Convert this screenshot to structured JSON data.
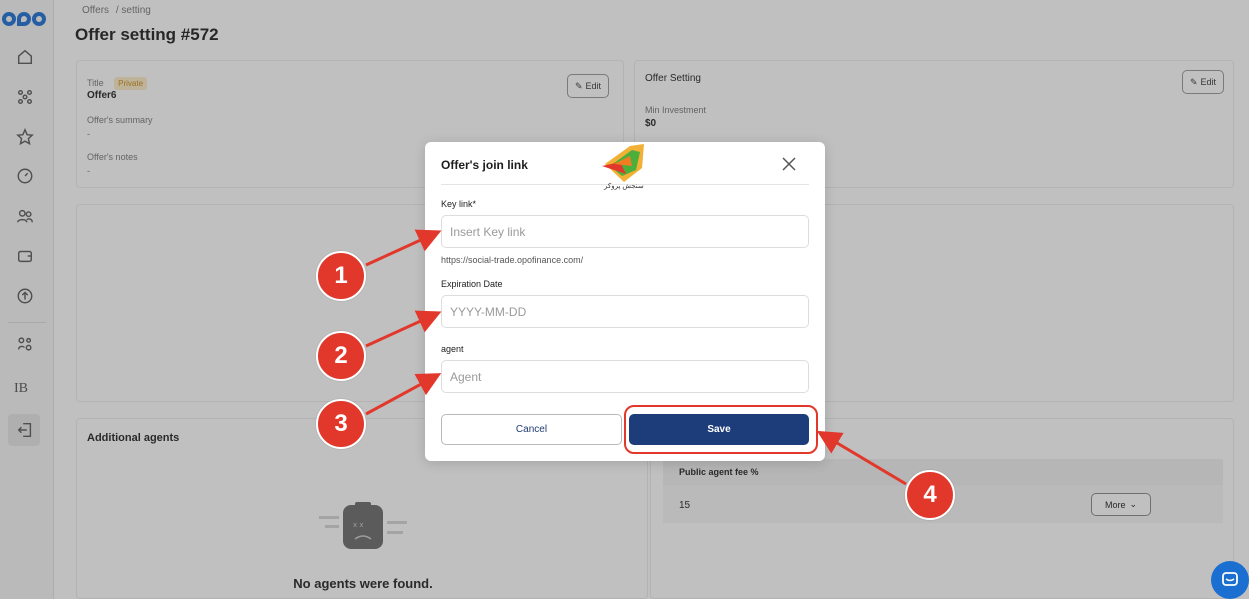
{
  "breadcrumb": {
    "root": "Offers",
    "current": "/ setting"
  },
  "page_title": "Offer setting #572",
  "offer_card": {
    "title_label": "Title",
    "badge": "Private",
    "title_value": "Offer6",
    "summary_label": "Offer's summary",
    "summary_value": "-",
    "notes_label": "Offer's notes",
    "notes_value": "-",
    "edit_label": "Edit"
  },
  "settings_card": {
    "heading": "Offer Setting",
    "min_investment_label": "Min Investment",
    "min_investment_value": "$0",
    "edit_label": "Edit"
  },
  "agents_card": {
    "heading": "Additional agents",
    "empty_text": "No agents were found."
  },
  "fee_card": {
    "column": "Public agent fee %",
    "value": "15",
    "more_label": "More"
  },
  "sidebar": {
    "ib_label": "IB"
  },
  "modal": {
    "title": "Offer's join link",
    "key_link_label": "Key link*",
    "key_link_placeholder": "Insert Key link",
    "key_link_value": "",
    "url_hint": "https://social-trade.opofinance.com/",
    "expiration_label": "Expiration Date",
    "expiration_placeholder": "YYYY-MM-DD",
    "expiration_value": "",
    "agent_label": "agent",
    "agent_placeholder": "Agent",
    "agent_value": "",
    "cancel_label": "Cancel",
    "save_label": "Save"
  },
  "watermark_text": "سنجش پروکر",
  "markers": [
    "1",
    "2",
    "3",
    "4"
  ],
  "colors": {
    "accent": "#1d3d7a",
    "marker": "#e2382b",
    "brand": "#1d6fd6"
  }
}
